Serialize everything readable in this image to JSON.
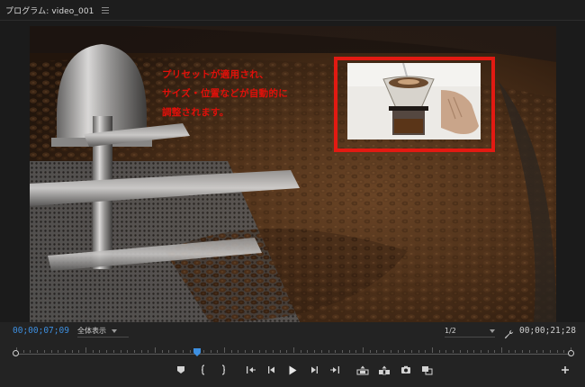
{
  "panel": {
    "title": "プログラム: video_001",
    "menu_icon": "hamburger-menu-icon"
  },
  "overlay": {
    "lines": [
      "プリセットが適用され、",
      "サイズ・位置などが自動的に",
      "調整されます。"
    ],
    "highlight_color": "#e21a12"
  },
  "controls": {
    "current_timecode": "00;00;07;09",
    "fit_label": "全体表示",
    "resolution_label": "1/2",
    "duration_timecode": "00;00;21;28",
    "settings_icon": "wrench-icon"
  },
  "transport": {
    "buttons": [
      "add-marker-icon",
      "mark-in-icon",
      "mark-out-icon",
      "go-to-in-icon",
      "step-back-icon",
      "play-icon",
      "step-forward-icon",
      "go-to-out-icon",
      "lift-icon",
      "extract-icon",
      "export-frame-icon",
      "compare-view-icon",
      "button-editor-icon"
    ]
  },
  "colors": {
    "accent_timecode": "#3d8fe0",
    "playhead": "#3d8fe0"
  }
}
